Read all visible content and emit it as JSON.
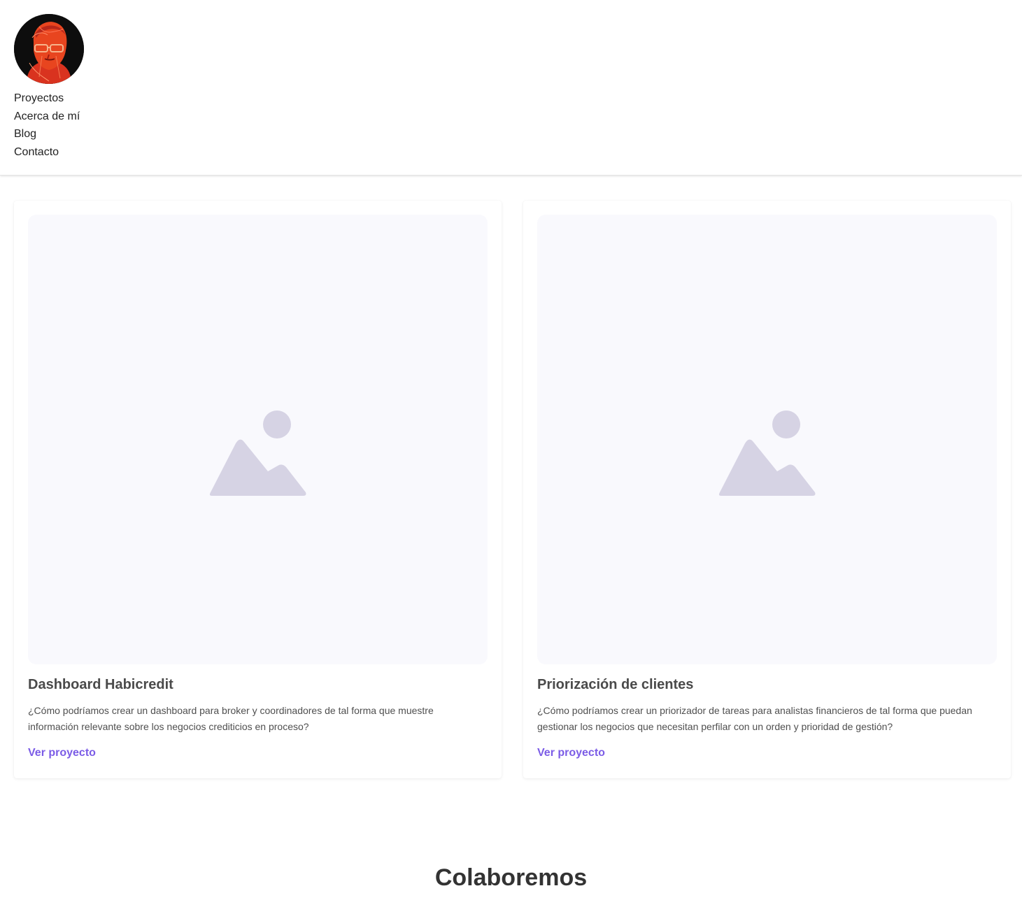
{
  "header": {
    "avatar_label": "",
    "nav": [
      {
        "label": "Proyectos"
      },
      {
        "label": "Acerca de mí"
      },
      {
        "label": "Blog"
      },
      {
        "label": "Contacto"
      }
    ]
  },
  "projects": [
    {
      "title": "Dashboard Habicredit",
      "description": "¿Cómo podríamos crear un dashboard para broker y coordinadores de tal forma que muestre información relevante sobre los negocios crediticios en proceso?",
      "link_label": "Ver proyecto",
      "image_icon": "image-placeholder-icon"
    },
    {
      "title": "Priorización de clientes",
      "description": "¿Cómo podríamos crear un priorizador de tareas para analistas financieros de tal forma que puedan gestionar los negocios que necesitan perfilar con un orden y prioridad de gestión?",
      "link_label": "Ver proyecto",
      "image_icon": "image-placeholder-icon"
    }
  ],
  "collaborate": {
    "title": "Colaboremos"
  },
  "colors": {
    "accent": "#7b5ce6",
    "placeholder_bg": "#f9f9fd",
    "placeholder_icon": "#d6d3e4",
    "avatar_red": "#e8321e"
  }
}
